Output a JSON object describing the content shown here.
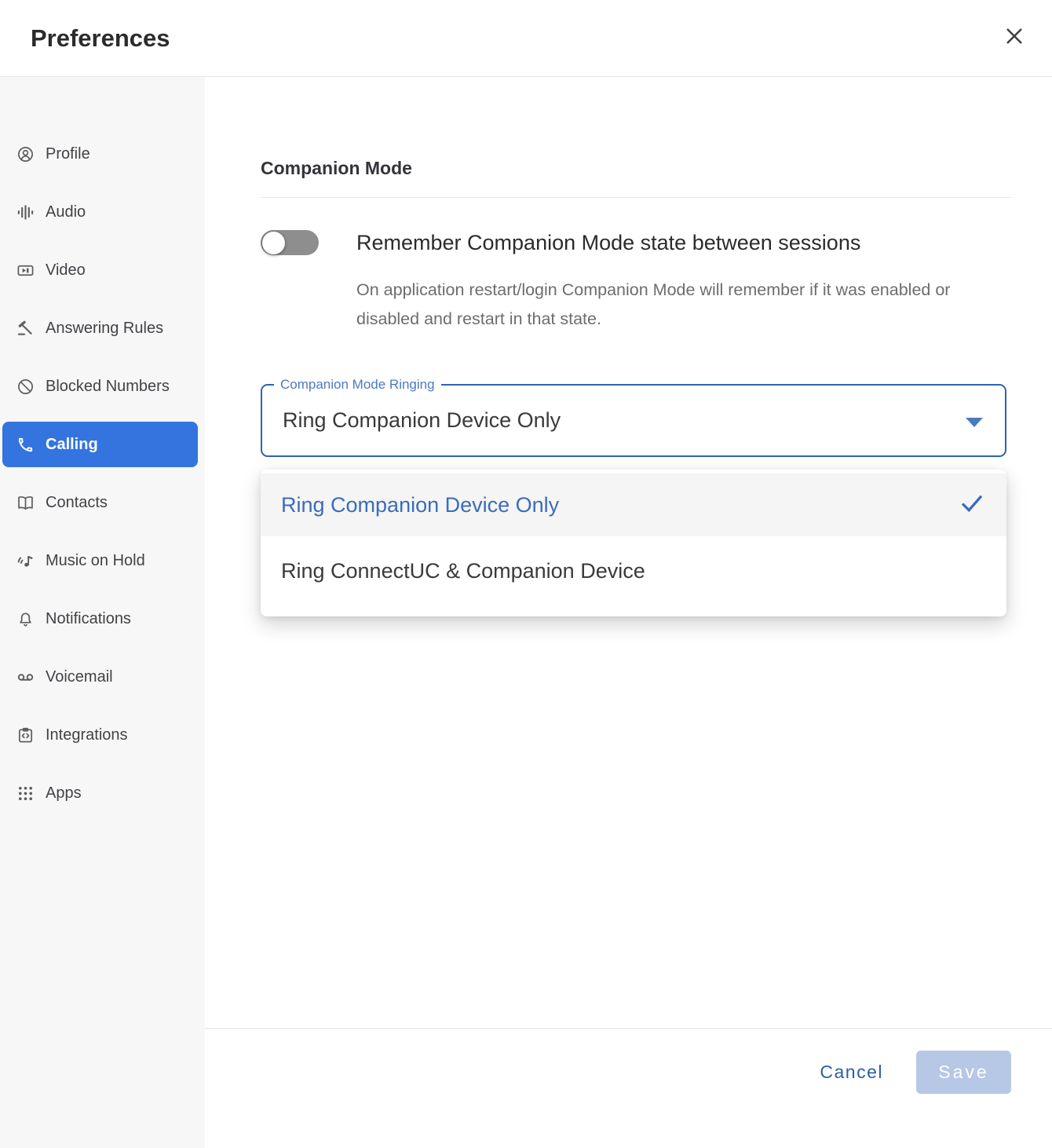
{
  "window": {
    "title": "Preferences",
    "close_icon": "✕"
  },
  "sidebar": {
    "items": [
      {
        "label": "Profile",
        "icon": "profile-icon",
        "selected": false
      },
      {
        "label": "Audio",
        "icon": "audio-icon",
        "selected": false
      },
      {
        "label": "Video",
        "icon": "video-icon",
        "selected": false
      },
      {
        "label": "Answering Rules",
        "icon": "gavel-icon",
        "selected": false
      },
      {
        "label": "Blocked Numbers",
        "icon": "blocked-icon",
        "selected": false
      },
      {
        "label": "Calling",
        "icon": "phone-icon",
        "selected": true
      },
      {
        "label": "Contacts",
        "icon": "book-icon",
        "selected": false
      },
      {
        "label": "Music on Hold",
        "icon": "music-icon",
        "selected": false
      },
      {
        "label": "Notifications",
        "icon": "bell-icon",
        "selected": false
      },
      {
        "label": "Voicemail",
        "icon": "voicemail-icon",
        "selected": false
      },
      {
        "label": "Integrations",
        "icon": "integrations-icon",
        "selected": false
      },
      {
        "label": "Apps",
        "icon": "apps-grid-icon",
        "selected": false
      }
    ]
  },
  "companion_mode": {
    "section_title": "Companion Mode",
    "remember_toggle": {
      "state": "off",
      "label": "Remember Companion Mode state between sessions",
      "description": "On application restart/login Companion Mode will remember if it was enabled or disabled and restart in that state."
    },
    "ringing_select": {
      "label": "Companion Mode Ringing",
      "value": "Ring Companion Device Only",
      "expanded": true,
      "dropdown_arrow_icon": "▾",
      "options": [
        {
          "label": "Ring Companion Device Only",
          "selected": true,
          "check_icon": "✓"
        },
        {
          "label": "Ring ConnectUC & Companion Device",
          "selected": false
        }
      ]
    }
  },
  "footer": {
    "cancel_label": "Cancel",
    "save_label": "Save",
    "save_enabled": false
  },
  "colors": {
    "accent_blue": "#3374DF",
    "select_border_blue": "#2D63B5",
    "select_label_blue": "#4A7AC5",
    "option_selected_text": "#3A6CBE",
    "cancel_text": "#2C5CAB",
    "save_disabled_bg": "#B7C7E6",
    "sidebar_bg": "#F7F7F7",
    "toggle_off_track": "#8E8E8E"
  }
}
